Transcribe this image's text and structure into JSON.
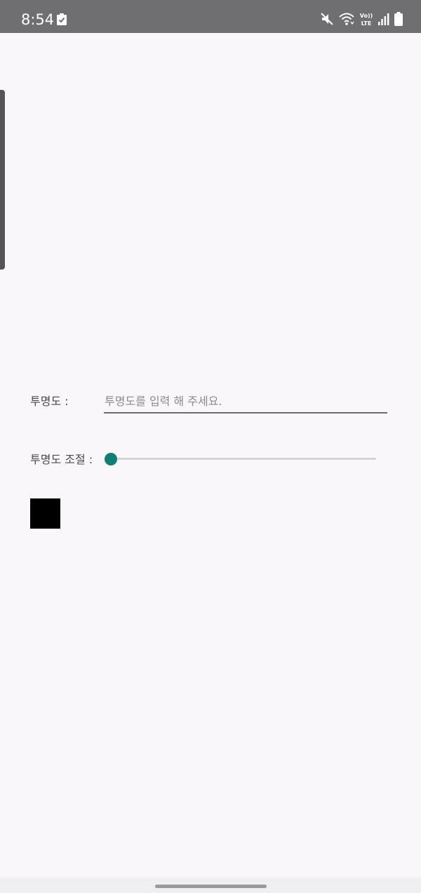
{
  "status_bar": {
    "time": "8:54",
    "notification_icon": "checkbox-notification-icon",
    "icons": [
      "mute-icon",
      "wifi-icon",
      "volte-icon",
      "signal-icon",
      "battery-icon"
    ],
    "volte_line1": "Vo))",
    "volte_line2": "LTE"
  },
  "form": {
    "opacity_label": "투명도 :",
    "opacity_input_value": "",
    "opacity_input_placeholder": "투명도를 입력 해 주세요.",
    "slider_label": "투명도 조절 :",
    "slider_value": 0,
    "slider_max": 100
  },
  "preview": {
    "color": "#000000"
  },
  "colors": {
    "accent": "#0e7f74",
    "background": "#f9f7fa",
    "status_bar": "#6f6e70"
  }
}
